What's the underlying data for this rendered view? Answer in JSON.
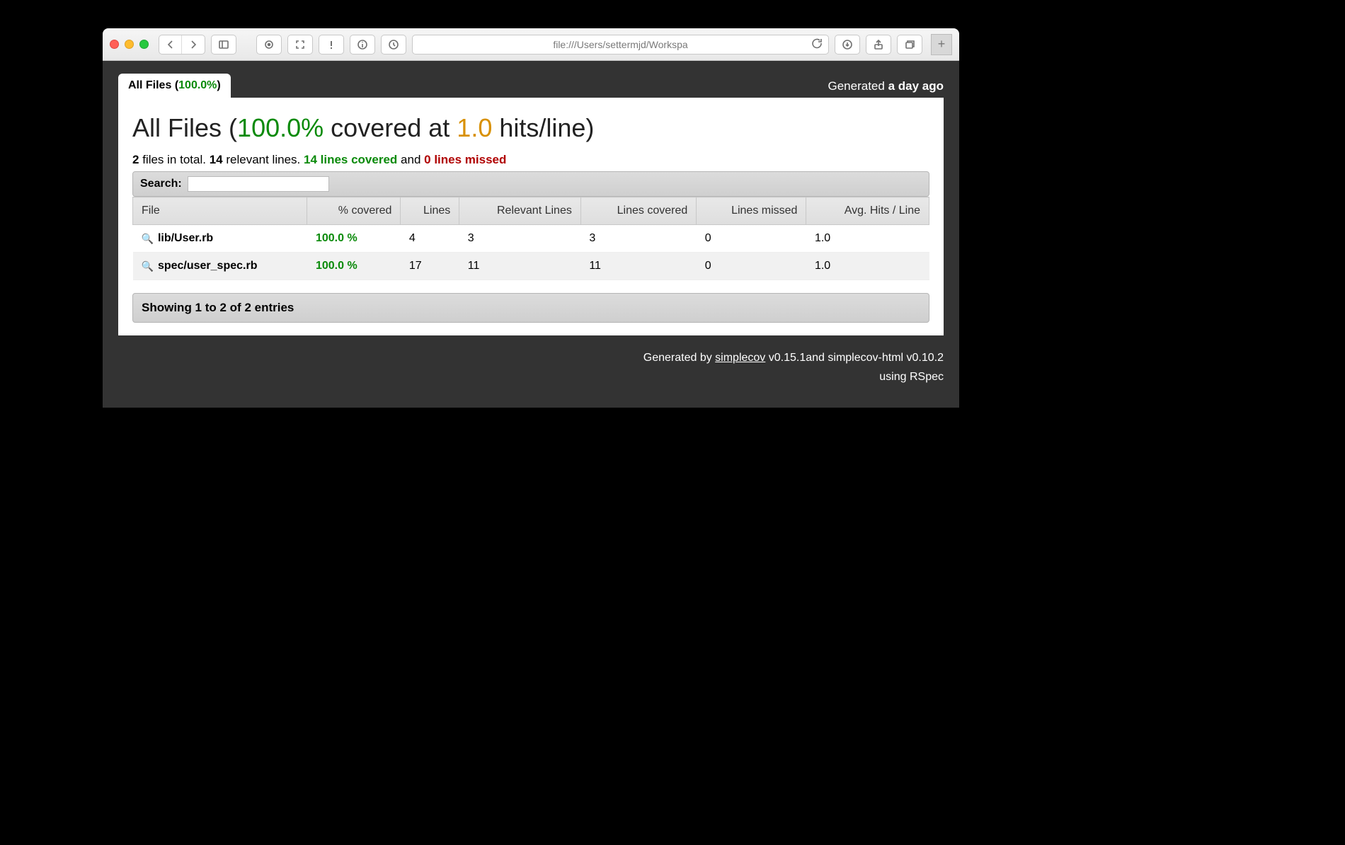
{
  "browser": {
    "url": "file:///Users/settermjd/Workspa"
  },
  "tab": {
    "label": "All Files",
    "pct": "100.0%"
  },
  "generated": {
    "prefix": "Generated",
    "when": "a day ago"
  },
  "heading": {
    "label": "All Files",
    "pct": "100.0%",
    "mid": "covered at",
    "hits": "1.0",
    "tail": "hits/line"
  },
  "stats": {
    "files_n": "2",
    "files_t": "files in total.",
    "rel_n": "14",
    "rel_t": "relevant lines.",
    "cov_n": "14 lines covered",
    "and": "and",
    "miss_n": "0 lines missed"
  },
  "search_label": "Search:",
  "columns": {
    "file": "File",
    "pct": "% covered",
    "lines": "Lines",
    "rel": "Relevant Lines",
    "cov": "Lines covered",
    "miss": "Lines missed",
    "avg": "Avg. Hits / Line"
  },
  "rows": [
    {
      "file": "lib/User.rb",
      "pct": "100.0 %",
      "lines": "4",
      "rel": "3",
      "cov": "3",
      "miss": "0",
      "avg": "1.0"
    },
    {
      "file": "spec/user_spec.rb",
      "pct": "100.0 %",
      "lines": "17",
      "rel": "11",
      "cov": "11",
      "miss": "0",
      "avg": "1.0"
    }
  ],
  "entries_text": "Showing 1 to 2 of 2 entries",
  "footer": {
    "line1a": "Generated by ",
    "tool": "simplecov",
    "line1b": " v0.15.1and simplecov-html v0.10.2",
    "line2": "using RSpec"
  }
}
